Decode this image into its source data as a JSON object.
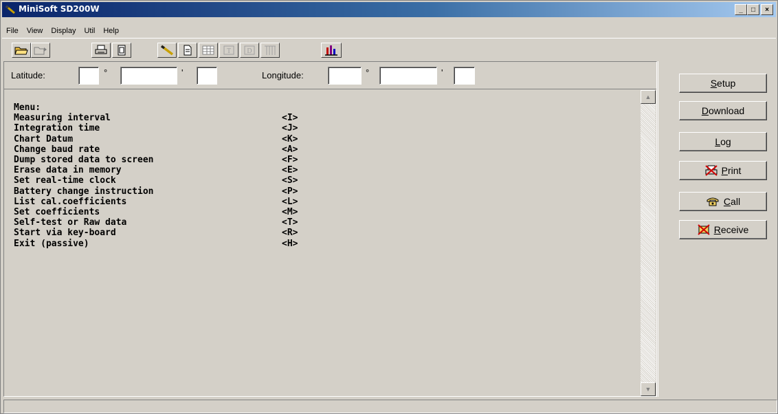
{
  "window": {
    "title": "MiniSoft SD200W"
  },
  "title_buttons": {
    "minimize": "_",
    "maximize": "□",
    "close": "×"
  },
  "menu": [
    "File",
    "View",
    "Display",
    "Util",
    "Help"
  ],
  "toolbar": {
    "icons": [
      "open-folder-icon",
      "open-file-icon",
      "printer-icon",
      "page-icon",
      "pen-icon",
      "document-icon",
      "table-icon",
      "t-icon",
      "d-icon",
      "grid-icon",
      "bars-chart-icon"
    ]
  },
  "coords": {
    "latitude_label": "Latitude:",
    "longitude_label": "Longitude:",
    "degree_symbol": "°",
    "minute_symbol": "'",
    "lat_deg": "",
    "lat_min": "",
    "lat_sec": "",
    "lon_deg": "",
    "lon_min": "",
    "lon_sec": ""
  },
  "console": {
    "heading": "Menu:",
    "items": [
      {
        "label": "Measuring interval",
        "key": "<I>"
      },
      {
        "label": "Integration time",
        "key": "<J>"
      },
      {
        "label": "Chart Datum",
        "key": "<K>"
      },
      {
        "label": "Change baud rate",
        "key": "<A>"
      },
      {
        "label": "Dump stored data to screen",
        "key": "<F>"
      },
      {
        "label": "Erase data in memory",
        "key": "<E>"
      },
      {
        "label": "Set real-time clock",
        "key": "<S>"
      },
      {
        "label": "Battery change instruction",
        "key": "<P>"
      },
      {
        "label": "List cal.coefficients",
        "key": "<L>"
      },
      {
        "label": "Set coefficients",
        "key": "<M>"
      },
      {
        "label": "Self-test or Raw data",
        "key": "<T>"
      },
      {
        "label": "Start via key-board",
        "key": "<R>"
      },
      {
        "label": "Exit (passive)",
        "key": "<H>"
      }
    ]
  },
  "side_buttons": [
    {
      "name": "setup-button",
      "accel": "S",
      "rest": "etup",
      "icon": ""
    },
    {
      "name": "download-button",
      "accel": "D",
      "rest": "ownload",
      "icon": ""
    },
    {
      "name": "log-button",
      "accel": "L",
      "rest": "og",
      "icon": ""
    },
    {
      "name": "print-button",
      "accel": "P",
      "rest": "rint",
      "icon": "printer-crossed-icon"
    },
    {
      "name": "call-button",
      "accel": "C",
      "rest": "all",
      "icon": "telephone-icon"
    },
    {
      "name": "receive-button",
      "accel": "R",
      "rest": "eceive",
      "icon": "receive-crossed-icon"
    }
  ],
  "colors": {
    "titlebar_start": "#0a246a",
    "titlebar_end": "#a6caf0",
    "face": "#d4d0c8"
  }
}
